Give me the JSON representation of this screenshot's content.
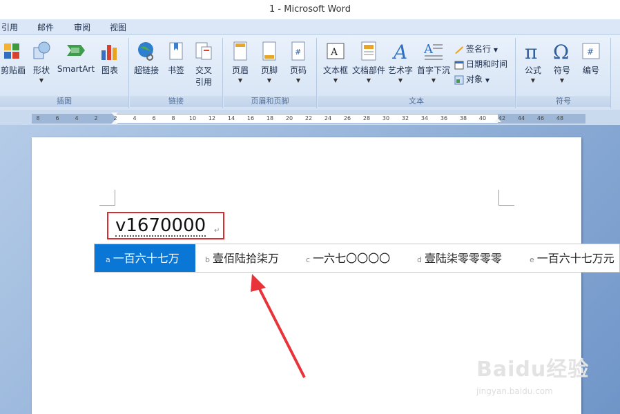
{
  "window": {
    "title": "1 - Microsoft Word"
  },
  "tabs": [
    "引用",
    "邮件",
    "审阅",
    "视图"
  ],
  "ribbon": {
    "groups": {
      "illustrations": {
        "label": "插图",
        "buttons": [
          "剪贴画",
          "形状",
          "SmartArt",
          "图表"
        ]
      },
      "links": {
        "label": "链接",
        "buttons": [
          "超链接",
          "书签",
          "交叉",
          "引用"
        ]
      },
      "header_footer": {
        "label": "页眉和页脚",
        "buttons": [
          "页眉",
          "页脚",
          "页码"
        ]
      },
      "text": {
        "label": "文本",
        "buttons": [
          "文本框",
          "文档部件",
          "艺术字",
          "首字下沉"
        ],
        "small": [
          "签名行",
          "日期和时间",
          "对象"
        ]
      },
      "symbols": {
        "label": "符号",
        "buttons": [
          "公式",
          "符号",
          "编号"
        ]
      }
    }
  },
  "ruler": {
    "ticks": [
      "8",
      "6",
      "4",
      "2",
      "2",
      "4",
      "6",
      "8",
      "10",
      "12",
      "14",
      "16",
      "18",
      "20",
      "22",
      "24",
      "26",
      "28",
      "30",
      "32",
      "34",
      "36",
      "38",
      "40",
      "42",
      "44",
      "46",
      "48"
    ]
  },
  "document": {
    "typed_text": "v1670000",
    "paragraph_mark": "↵"
  },
  "ime": {
    "candidates": [
      {
        "key": "a",
        "text": "一百六十七万",
        "selected": true
      },
      {
        "key": "b",
        "text": "壹佰陆拾柒万",
        "selected": false
      },
      {
        "key": "c",
        "text": "一六七〇〇〇〇",
        "selected": false
      },
      {
        "key": "d",
        "text": "壹陆柒零零零零",
        "selected": false
      },
      {
        "key": "e",
        "text": "一百六十七万元",
        "selected": false
      }
    ]
  },
  "watermark": {
    "brand": "Baidu经验",
    "url": "jingyan.baidu.com"
  },
  "colors": {
    "highlight_box": "#e0292f",
    "selected_candidate": "#0a76d6",
    "arrow": "#e8333a"
  }
}
